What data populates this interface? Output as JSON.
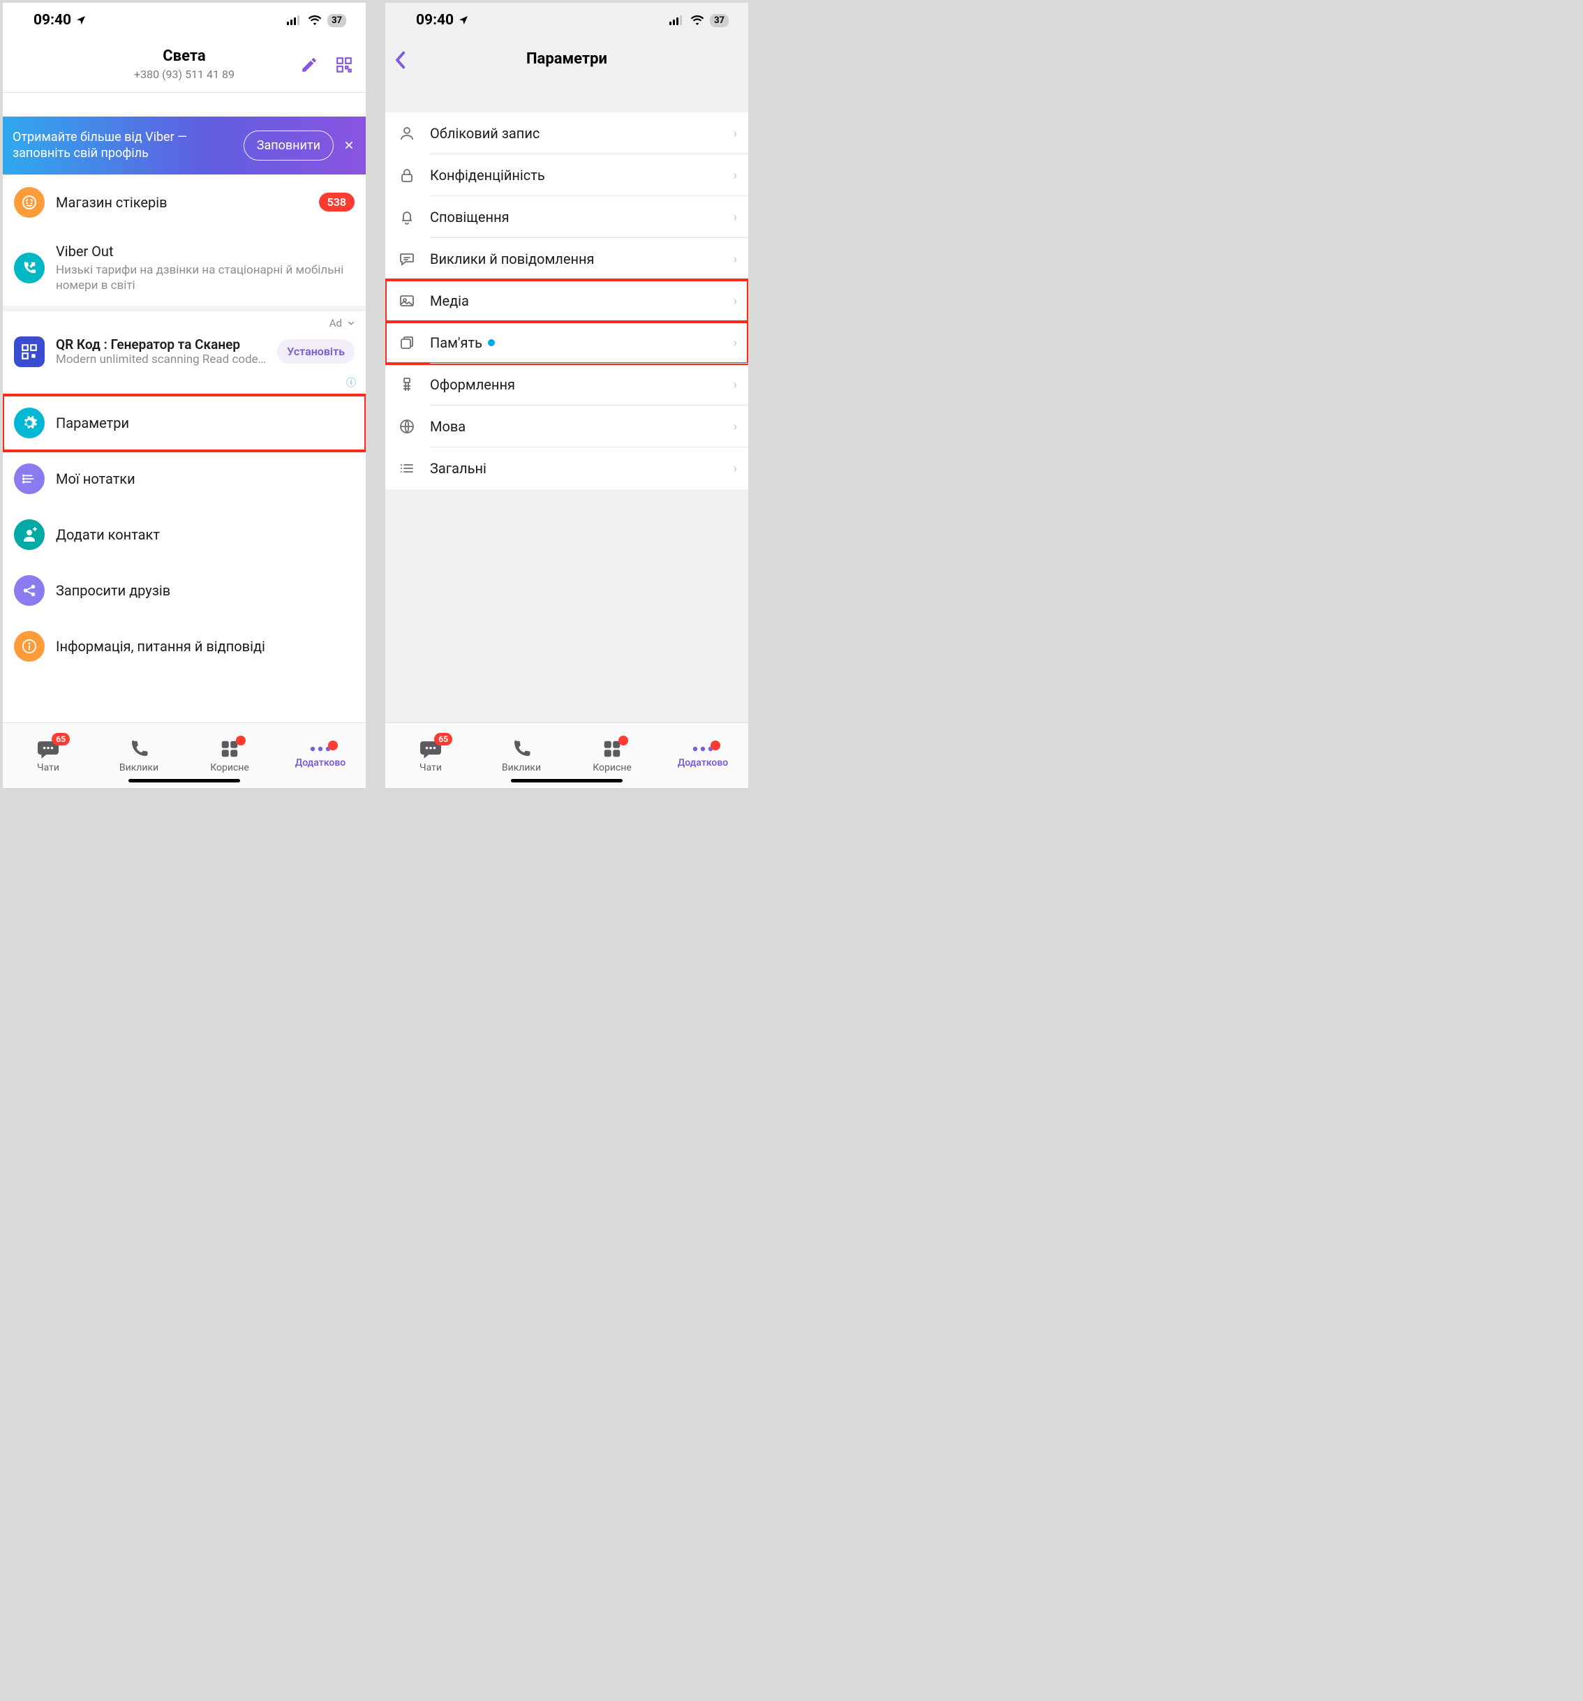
{
  "status": {
    "time": "09:40",
    "battery": "37"
  },
  "left": {
    "profile": {
      "name": "Света",
      "phone": "+380 (93) 511 41 89"
    },
    "promo": {
      "text": "Отримайте більше від Viber — заповніть свій профіль",
      "button": "Заповнити"
    },
    "stickers": {
      "label": "Магазин стікерів",
      "badge": "538"
    },
    "viberout": {
      "label": "Viber Out",
      "sub": "Низькі тарифи на дзвінки на стаціонарні й мобільні номери в світі"
    },
    "ad": {
      "tag": "Ad",
      "title": "QR Код : Генератор та Сканер",
      "desc": "Modern unlimited scanning Read codes…",
      "install": "Установіть"
    },
    "items": {
      "settings": "Параметри",
      "notes": "Мої нотатки",
      "add_contact": "Додати контакт",
      "invite": "Запросити друзів",
      "info": "Інформація, питання й відповіді"
    }
  },
  "right": {
    "title": "Параметри",
    "rows": {
      "account": "Обліковий запис",
      "privacy": "Конфіденційність",
      "notifications": "Сповіщення",
      "calls": "Виклики й повідомлення",
      "media": "Медіа",
      "storage": "Пам'ять",
      "appearance": "Оформлення",
      "language": "Мова",
      "general": "Загальні"
    }
  },
  "tabs": {
    "chats": {
      "label": "Чати",
      "badge": "65"
    },
    "calls": {
      "label": "Виклики"
    },
    "explore": {
      "label": "Корисне"
    },
    "more": {
      "label": "Додатково"
    }
  }
}
